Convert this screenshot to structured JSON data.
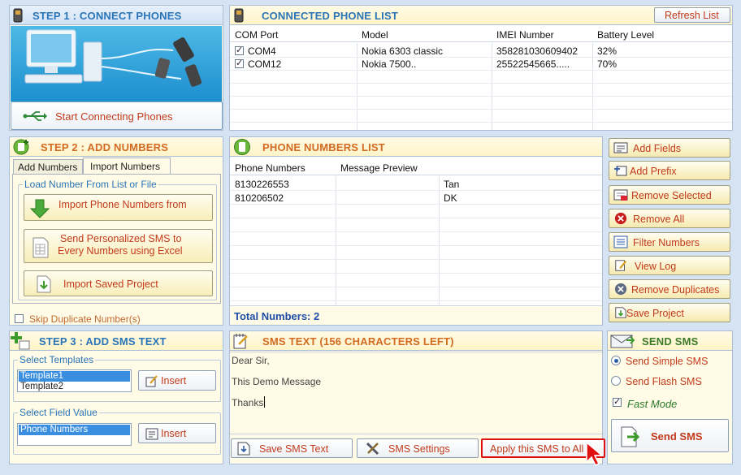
{
  "step1": {
    "title": "STEP 1 : CONNECT PHONES",
    "connect_label": "Start Connecting Phones"
  },
  "phones": {
    "title": "CONNECTED PHONE LIST",
    "refresh_label": "Refresh List",
    "columns": [
      "COM  Port",
      "Model",
      "IMEI Number",
      "Battery Level"
    ],
    "rows": [
      {
        "port": "COM4",
        "model": "Nokia 6303 classic",
        "imei": "358281030609402",
        "battery": "32%",
        "checked": true
      },
      {
        "port": "COM12",
        "model": "Nokia 7500..",
        "imei": "25522545665.....",
        "battery": "70%",
        "checked": true
      }
    ]
  },
  "step2": {
    "title": "STEP 2 : ADD NUMBERS",
    "tabs": [
      "Add Numbers",
      "Import Numbers"
    ],
    "group_label": "Load Number From List or File",
    "import_phone_label": "Import Phone Numbers from",
    "excel_line1": "Send Personalized SMS to",
    "excel_line2": "Every Numbers using Excel",
    "import_project_label": "Import Saved Project",
    "skip_duplicates_label": "Skip Duplicate Number(s)"
  },
  "numbers": {
    "title": "PHONE NUMBERS LIST",
    "columns": [
      "Phone Numbers",
      "Message Preview"
    ],
    "rows": [
      {
        "number": "8130226553",
        "preview": "",
        "extra": "Tan"
      },
      {
        "number": "810206502",
        "preview": "",
        "extra": "DK"
      }
    ],
    "total_label": "Total Numbers: 2"
  },
  "side_buttons": [
    "Add Fields",
    "Add Prefix",
    "Remove Selected",
    "Remove All",
    "Filter Numbers",
    "View Log",
    "Remove Duplicates",
    "Save Project"
  ],
  "step3": {
    "title": "STEP 3 : ADD SMS TEXT",
    "templates_label": "Select Templates",
    "templates": [
      "Template1",
      "Template2"
    ],
    "insert_label": "Insert",
    "field_label": "Select Field Value",
    "fields": [
      "Phone Numbers"
    ]
  },
  "sms_text": {
    "title": "SMS TEXT (156 CHARACTERS LEFT)",
    "lines": [
      "Dear Sir,",
      "This Demo Message",
      "Thanks"
    ],
    "save_label": "Save SMS Text",
    "settings_label": "SMS Settings",
    "apply_label": "Apply this SMS to All"
  },
  "send": {
    "title": "SEND SMS",
    "simple_label": "Send Simple SMS",
    "flash_label": "Send Flash SMS",
    "fast_label": "Fast Mode",
    "send_label": "Send SMS"
  },
  "colors": {
    "accent_blue": "#2a74b8",
    "accent_orange": "#d26a22",
    "button_text": "#c23a1b",
    "highlight_red": "#e01010"
  }
}
